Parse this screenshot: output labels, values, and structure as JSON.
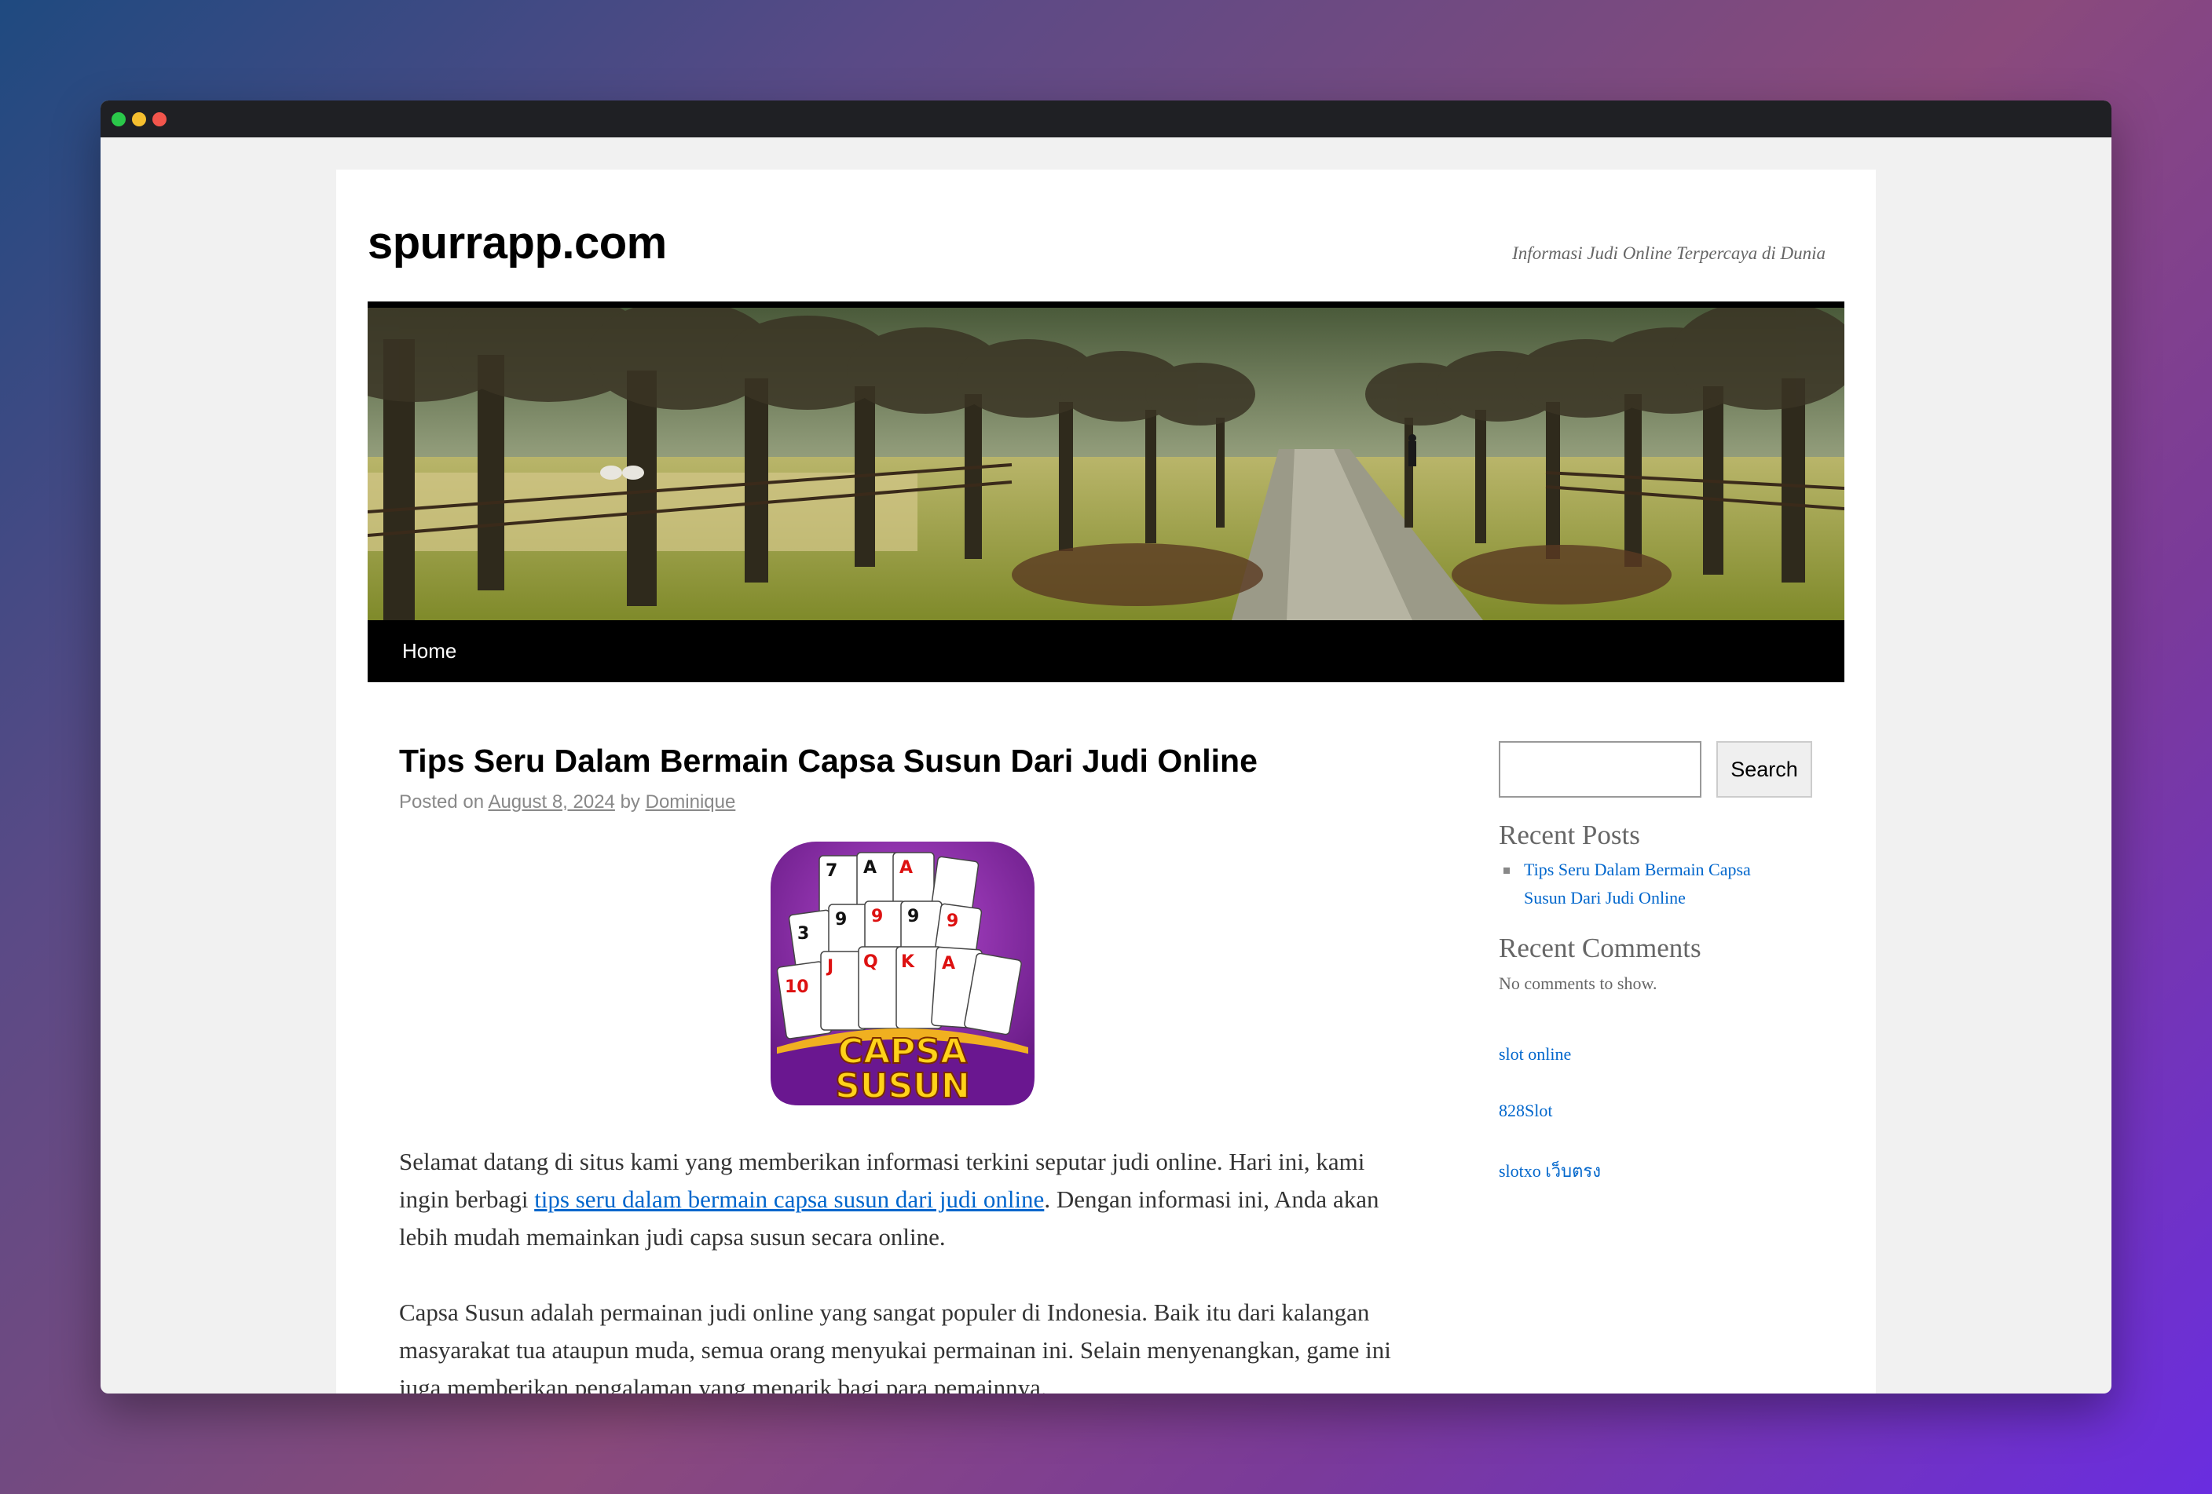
{
  "site": {
    "title": "spurrapp.com",
    "tagline": "Informasi Judi Online Terpercaya di Dunia"
  },
  "nav": {
    "home": "Home"
  },
  "post": {
    "title": "Tips Seru Dalam Bermain Capsa Susun Dari Judi Online",
    "meta_posted_on": "Posted on",
    "date": "August 8, 2024",
    "meta_by": "by",
    "author": "Dominique",
    "image": {
      "line1": "CAPSA",
      "line2": "SUSUN"
    },
    "paragraph1_before": "Selamat datang di situs kami yang memberikan informasi terkini seputar judi online. Hari ini, kami ingin berbagi ",
    "paragraph1_link": "tips seru dalam bermain capsa susun dari judi online",
    "paragraph1_after": ". Dengan informasi ini, Anda akan lebih mudah memainkan judi capsa susun secara online.",
    "paragraph2": "Capsa Susun adalah permainan judi online yang sangat populer di Indonesia. Baik itu dari kalangan masyarakat tua ataupun muda, semua orang menyukai permainan ini. Selain menyenangkan, game ini juga memberikan pengalaman yang menarik bagi para pemainnya."
  },
  "sidebar": {
    "search_value": "",
    "search_button": "Search",
    "recent_posts_title": "Recent Posts",
    "recent_posts": [
      "Tips Seru Dalam Bermain Capsa Susun Dari Judi Online"
    ],
    "recent_comments_title": "Recent Comments",
    "recent_comments_empty": "No comments to show.",
    "links": [
      "slot online",
      "828Slot",
      "slotxo เว็บตรง"
    ]
  },
  "colors": {
    "link": "#0066cc",
    "nav_bg": "#000000",
    "page_bg": "#f1f1f1"
  }
}
